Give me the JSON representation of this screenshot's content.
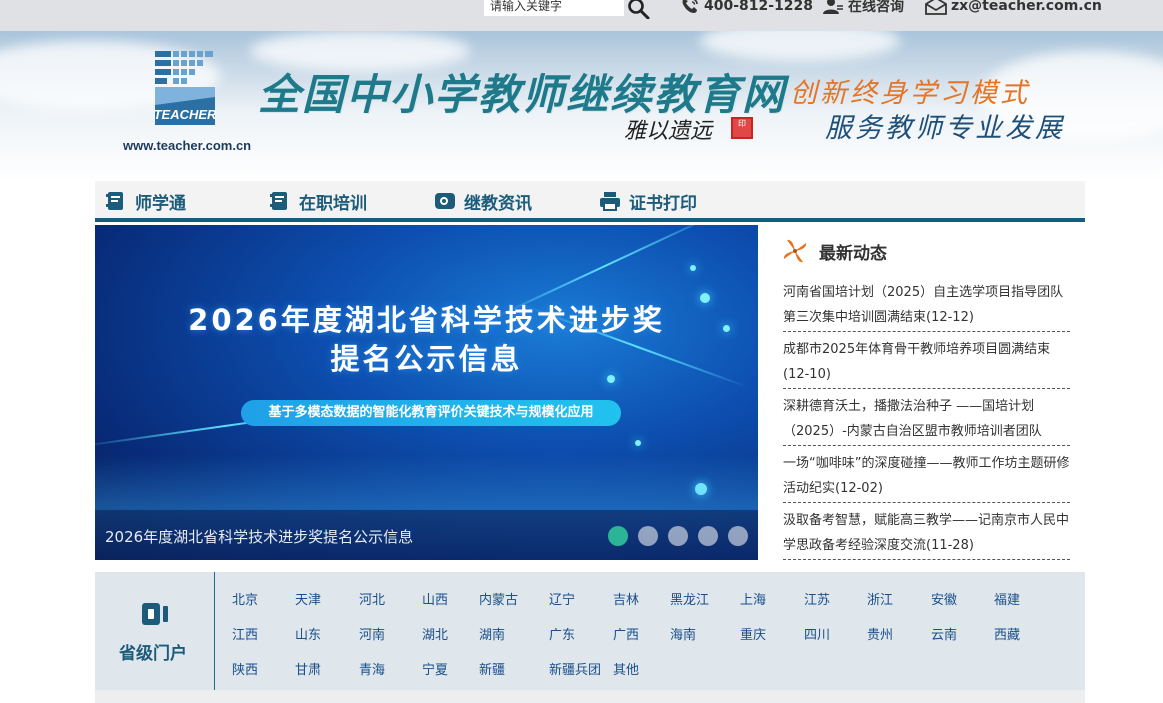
{
  "topbar": {
    "search_placeholder": "请输入关键字",
    "phone": "400-812-1228",
    "consult": "在线咨询",
    "email": "zx@teacher.com.cn"
  },
  "header": {
    "logo_text": "TEACHER",
    "logo_url": "www.teacher.com.cn",
    "site_title": "全国中小学教师继续教育网",
    "signature": "雅以遗远",
    "seal": "印",
    "slogan_line1": "创新终身学习模式",
    "slogan_line2": "服务教师专业发展"
  },
  "nav": {
    "items": [
      {
        "label": "师学通",
        "icon": "book-icon"
      },
      {
        "label": "在职培训",
        "icon": "book-icon"
      },
      {
        "label": "继教资讯",
        "icon": "news-icon"
      },
      {
        "label": "证书打印",
        "icon": "printer-icon"
      }
    ]
  },
  "banner": {
    "title_line1": "2026年度湖北省科学技术进步奖",
    "title_line2": "提名公示信息",
    "pill": "基于多模态数据的智能化教育评价关键技术与规模化应用",
    "caption": "2026年度湖北省科学技术进步奖提名公示信息",
    "active_page": 1,
    "page_count": 5
  },
  "news": {
    "title": "最新动态",
    "items": [
      "河南省国培计划（2025）自主选学项目指导团队第三次集中培训圆满结束(12-12)",
      "成都市2025年体育骨干教师培养项目圆满结束(12-10)",
      "深耕德育沃土，播撒法治种子 ——国培计划（2025）-内蒙古自治区盟市教师培训者团队",
      "一场“咖啡味”的深度碰撞——教师工作坊主题研修活动纪实(12-02)",
      "汲取备考智慧，赋能高三教学——记南京市人民中学思政备考经验深度交流(11-28)"
    ]
  },
  "provinces": {
    "label": "省级门户",
    "rows": [
      [
        "北京",
        "天津",
        "河北",
        "山西",
        "内蒙古",
        "辽宁",
        "吉林",
        "黑龙江",
        "上海",
        "江苏",
        "浙江",
        "安徽",
        "福建"
      ],
      [
        "江西",
        "山东",
        "河南",
        "湖北",
        "湖南",
        "广东",
        "广西",
        "海南",
        "重庆",
        "四川",
        "贵州",
        "云南",
        "西藏"
      ],
      [
        "陕西",
        "甘肃",
        "青海",
        "宁夏",
        "新疆",
        "新疆兵团",
        "其他"
      ]
    ]
  },
  "colors": {
    "nav_text": "#1c5c7a",
    "nav_border": "#135f7e",
    "slogan_orange": "#e57525",
    "title_teal": "#1e7a8a",
    "province_link": "#1a4f8a",
    "pager_active": "#2bb596"
  }
}
